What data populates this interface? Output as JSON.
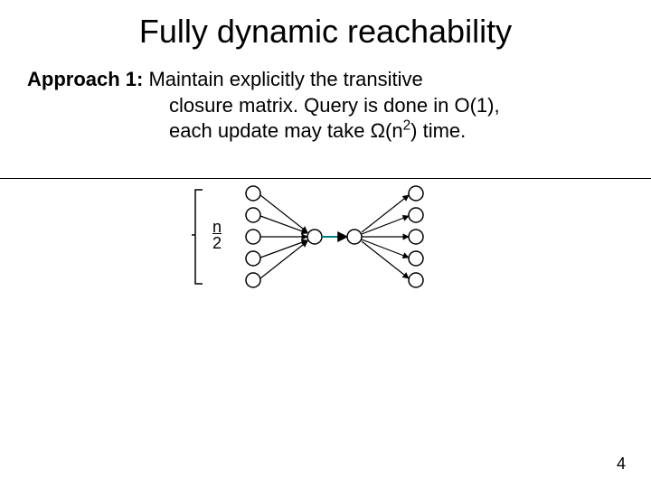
{
  "title": "Fully dynamic reachability",
  "approach_label": "Approach 1:",
  "line1_rest": " Maintain explicitly the transitive",
  "line2": "closure matrix. Query is done in O(1),",
  "line3_a": "each update may take ",
  "line3_omega": "Ω",
  "line3_b": "(n",
  "line3_sup": "2",
  "line3_c": ") time.",
  "frac_top": "n",
  "frac_bot": "2",
  "page_number": "4"
}
